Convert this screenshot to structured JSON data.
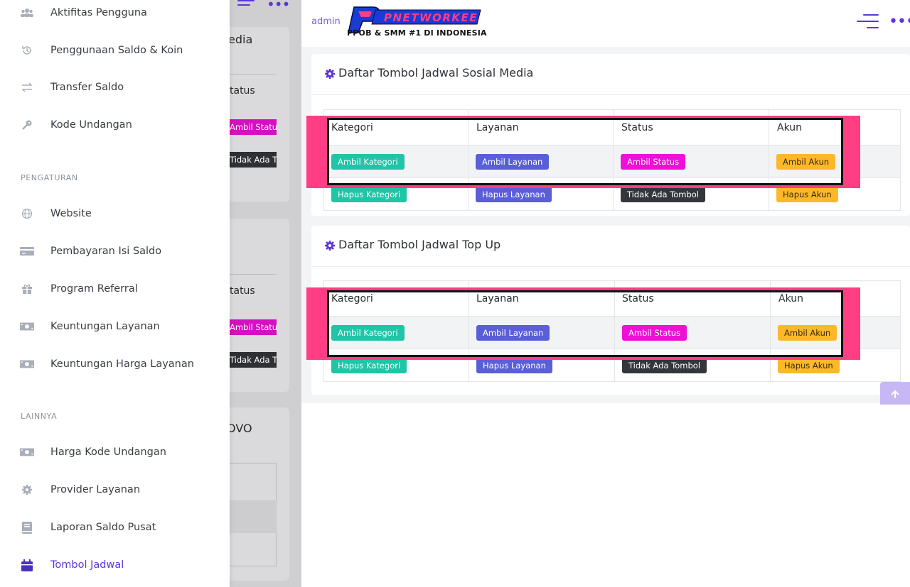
{
  "sidebar": {
    "items_top": [
      {
        "label": "Aktifitas Pengguna",
        "icon": "users-icon"
      },
      {
        "label": "Penggunaan Saldo & Koin",
        "icon": "history-icon"
      },
      {
        "label": "Transfer Saldo",
        "icon": "transfer-icon"
      },
      {
        "label": "Kode Undangan",
        "icon": "key-icon"
      }
    ],
    "section_pengaturan": "PENGATURAN",
    "items_pengaturan": [
      {
        "label": "Website",
        "icon": "globe-icon"
      },
      {
        "label": "Pembayaran Isi Saldo",
        "icon": "card-icon"
      },
      {
        "label": "Program Referral",
        "icon": "gift-icon"
      },
      {
        "label": "Keuntungan Layanan",
        "icon": "money-icon"
      },
      {
        "label": "Keuntungan Harga Layanan",
        "icon": "money-icon"
      }
    ],
    "section_lainnya": "LAINNYA",
    "items_lainnya": [
      {
        "label": "Harga Kode Undangan",
        "icon": "money-icon"
      },
      {
        "label": "Provider Layanan",
        "icon": "gear-icon"
      },
      {
        "label": "Laporan Saldo Pusat",
        "icon": "book-icon"
      },
      {
        "label": "Tombol Jadwal",
        "icon": "calendar-icon",
        "active": true
      }
    ]
  },
  "backdrop": {
    "texts": [
      "edia",
      "tatus",
      "tatus",
      "OVO"
    ],
    "badges": [
      "Ambil Statu",
      "Tidak Ada T",
      "Ambil Statu",
      "Tidak Ada T"
    ]
  },
  "header": {
    "admin_label": "admin",
    "logo_text": "PNETWORKEE",
    "logo_sub": "PPOB & SMM #1 DI INDONESIA"
  },
  "cards": [
    {
      "title": "Daftar Tombol Jadwal Sosial Media",
      "columns": [
        "Kategori",
        "Layanan",
        "Status",
        "Akun"
      ],
      "rows": [
        [
          "Ambil Kategori",
          "Ambil Layanan",
          "Ambil Status",
          "Ambil Akun"
        ],
        [
          "Hapus Kategori",
          "Hapus Layanan",
          "Tidak Ada Tombol",
          "Hapus Akun"
        ]
      ]
    },
    {
      "title": "Daftar Tombol Jadwal Top Up",
      "columns": [
        "Kategori",
        "Layanan",
        "Status",
        "Akun"
      ],
      "rows": [
        [
          "Ambil Kategori",
          "Ambil Layanan",
          "Ambil Status",
          "Ambil Akun"
        ],
        [
          "Hapus Kategori",
          "Hapus Layanan",
          "Tidak Ada Tombol",
          "Hapus Akun"
        ]
      ]
    }
  ],
  "colors": {
    "accent": "#5d36d8",
    "highlight": "#ff3e84",
    "teal": "#1fc5a6",
    "indigo": "#5a5fd8",
    "magenta": "#ee10d5",
    "orange": "#fbb82b",
    "dark": "#33363b"
  }
}
